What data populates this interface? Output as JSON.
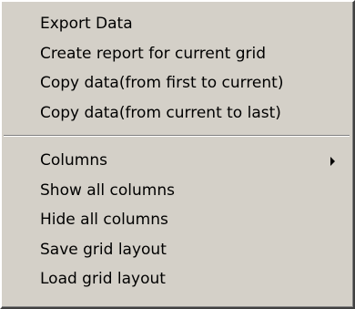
{
  "menu": {
    "group1": [
      {
        "label": "Export Data"
      },
      {
        "label": "Create report for current grid"
      },
      {
        "label": "Copy data(from first to current)"
      },
      {
        "label": "Copy data(from current to last)"
      }
    ],
    "group2": [
      {
        "label": "Columns",
        "has_submenu": true,
        "submenu_icon": "triangle-right-icon"
      },
      {
        "label": "Show all columns"
      },
      {
        "label": "Hide all columns"
      },
      {
        "label": "Save grid layout"
      },
      {
        "label": "Load grid layout"
      }
    ]
  },
  "colors": {
    "menu_background": "#d4d0c8",
    "text": "#000000",
    "separator_dark": "#808080",
    "separator_light": "#ffffff"
  }
}
